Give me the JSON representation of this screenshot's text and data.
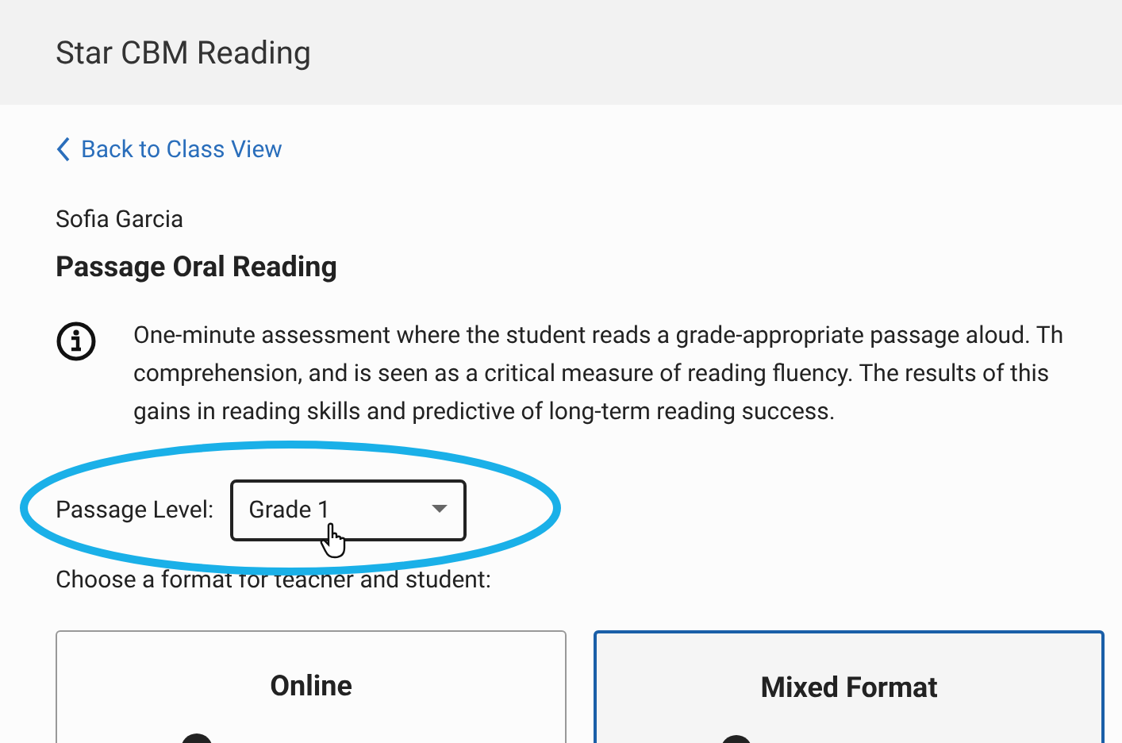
{
  "header": {
    "title": "Star CBM Reading"
  },
  "back_link": "Back to Class View",
  "student_name": "Sofia Garcia",
  "page_title": "Passage Oral Reading",
  "info_lines": [
    "One-minute assessment where the student reads a grade-appropriate passage aloud. Th",
    "comprehension, and is seen as a critical measure of reading fluency. The results of this",
    "gains in reading skills and predictive of long-term reading success."
  ],
  "passage_level": {
    "label": "Passage Level:",
    "value": "Grade 1"
  },
  "format_prompt": "Choose a format for teacher and student:",
  "formats": [
    {
      "title": "Online",
      "selected": false
    },
    {
      "title": "Mixed Format",
      "selected": true
    }
  ]
}
